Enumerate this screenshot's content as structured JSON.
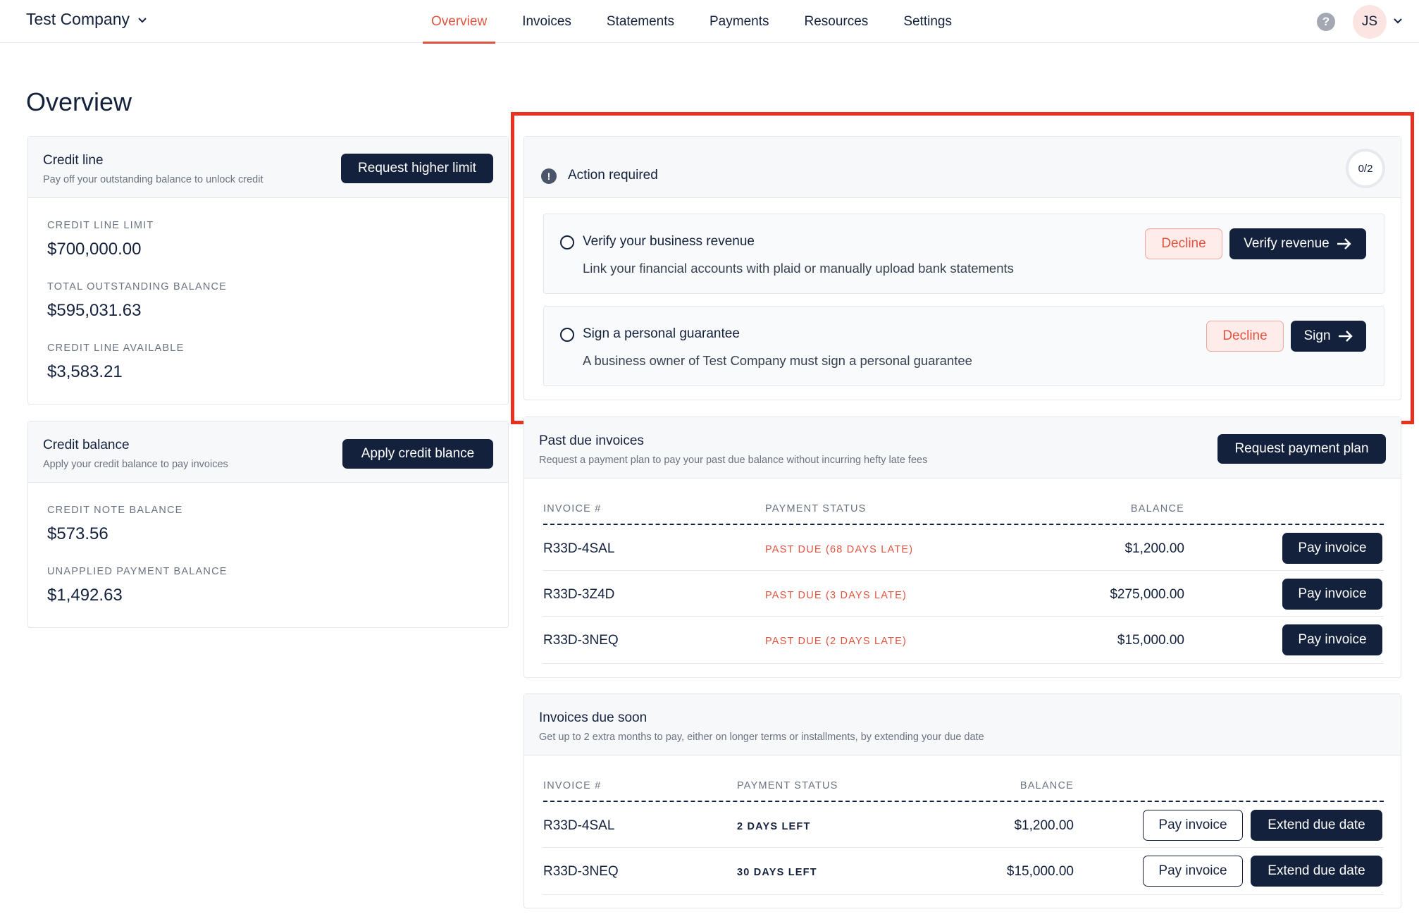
{
  "header": {
    "company": "Test Company",
    "tabs": [
      "Overview",
      "Invoices",
      "Statements",
      "Payments",
      "Resources",
      "Settings"
    ],
    "active_tab": "Overview",
    "help_glyph": "?",
    "user_initials": "JS"
  },
  "page_title": "Overview",
  "credit_line": {
    "title": "Credit line",
    "subtitle": "Pay off your outstanding balance to unlock credit",
    "button": "Request higher limit",
    "stats": [
      {
        "label": "CREDIT LINE LIMIT",
        "value": "$700,000.00"
      },
      {
        "label": "TOTAL OUTSTANDING BALANCE",
        "value": "$595,031.63"
      },
      {
        "label": "CREDIT LINE AVAILABLE",
        "value": "$3,583.21"
      }
    ]
  },
  "credit_balance": {
    "title": "Credit balance",
    "subtitle": "Apply your credit balance to pay invoices",
    "button": "Apply credit blance",
    "stats": [
      {
        "label": "CREDIT NOTE BALANCE",
        "value": "$573.56"
      },
      {
        "label": "UNAPPLIED PAYMENT BALANCE",
        "value": "$1,492.63"
      }
    ]
  },
  "action_required": {
    "title": "Action required",
    "progress": "0/2",
    "tasks": [
      {
        "title": "Verify your business revenue",
        "description": "Link your financial accounts with plaid or manually upload bank statements",
        "decline": "Decline",
        "action": "Verify revenue"
      },
      {
        "title": "Sign a personal guarantee",
        "description": "A business owner of Test Company must sign a personal guarantee",
        "decline": "Decline",
        "action": "Sign"
      }
    ]
  },
  "past_due": {
    "title": "Past due invoices",
    "subtitle": "Request a payment plan to pay your past due balance without incurring hefty late fees",
    "button": "Request payment plan",
    "columns": [
      "INVOICE #",
      "PAYMENT STATUS",
      "BALANCE"
    ],
    "rows": [
      {
        "invoice": "R33D-4SAL",
        "status": "PAST DUE (68 DAYS LATE)",
        "balance": "$1,200.00",
        "action": "Pay invoice"
      },
      {
        "invoice": "R33D-3Z4D",
        "status": "PAST DUE (3 DAYS LATE)",
        "balance": "$275,000.00",
        "action": "Pay invoice"
      },
      {
        "invoice": "R33D-3NEQ",
        "status": "PAST DUE (2 DAYS LATE)",
        "balance": "$15,000.00",
        "action": "Pay invoice"
      }
    ]
  },
  "due_soon": {
    "title": "Invoices due soon",
    "subtitle": "Get up to 2 extra months to pay, either on longer terms or installments, by extending your due date",
    "columns": [
      "INVOICE #",
      "PAYMENT STATUS",
      "BALANCE"
    ],
    "rows": [
      {
        "invoice": "R33D-4SAL",
        "status": "2 DAYS LEFT",
        "balance": "$1,200.00",
        "pay": "Pay invoice",
        "extend": "Extend due date"
      },
      {
        "invoice": "R33D-3NEQ",
        "status": "30 DAYS LEFT",
        "balance": "$15,000.00",
        "pay": "Pay invoice",
        "extend": "Extend due date"
      }
    ]
  },
  "colors": {
    "navy": "#14213d",
    "accent": "#e0533f",
    "highlight_border": "#e8321f"
  }
}
